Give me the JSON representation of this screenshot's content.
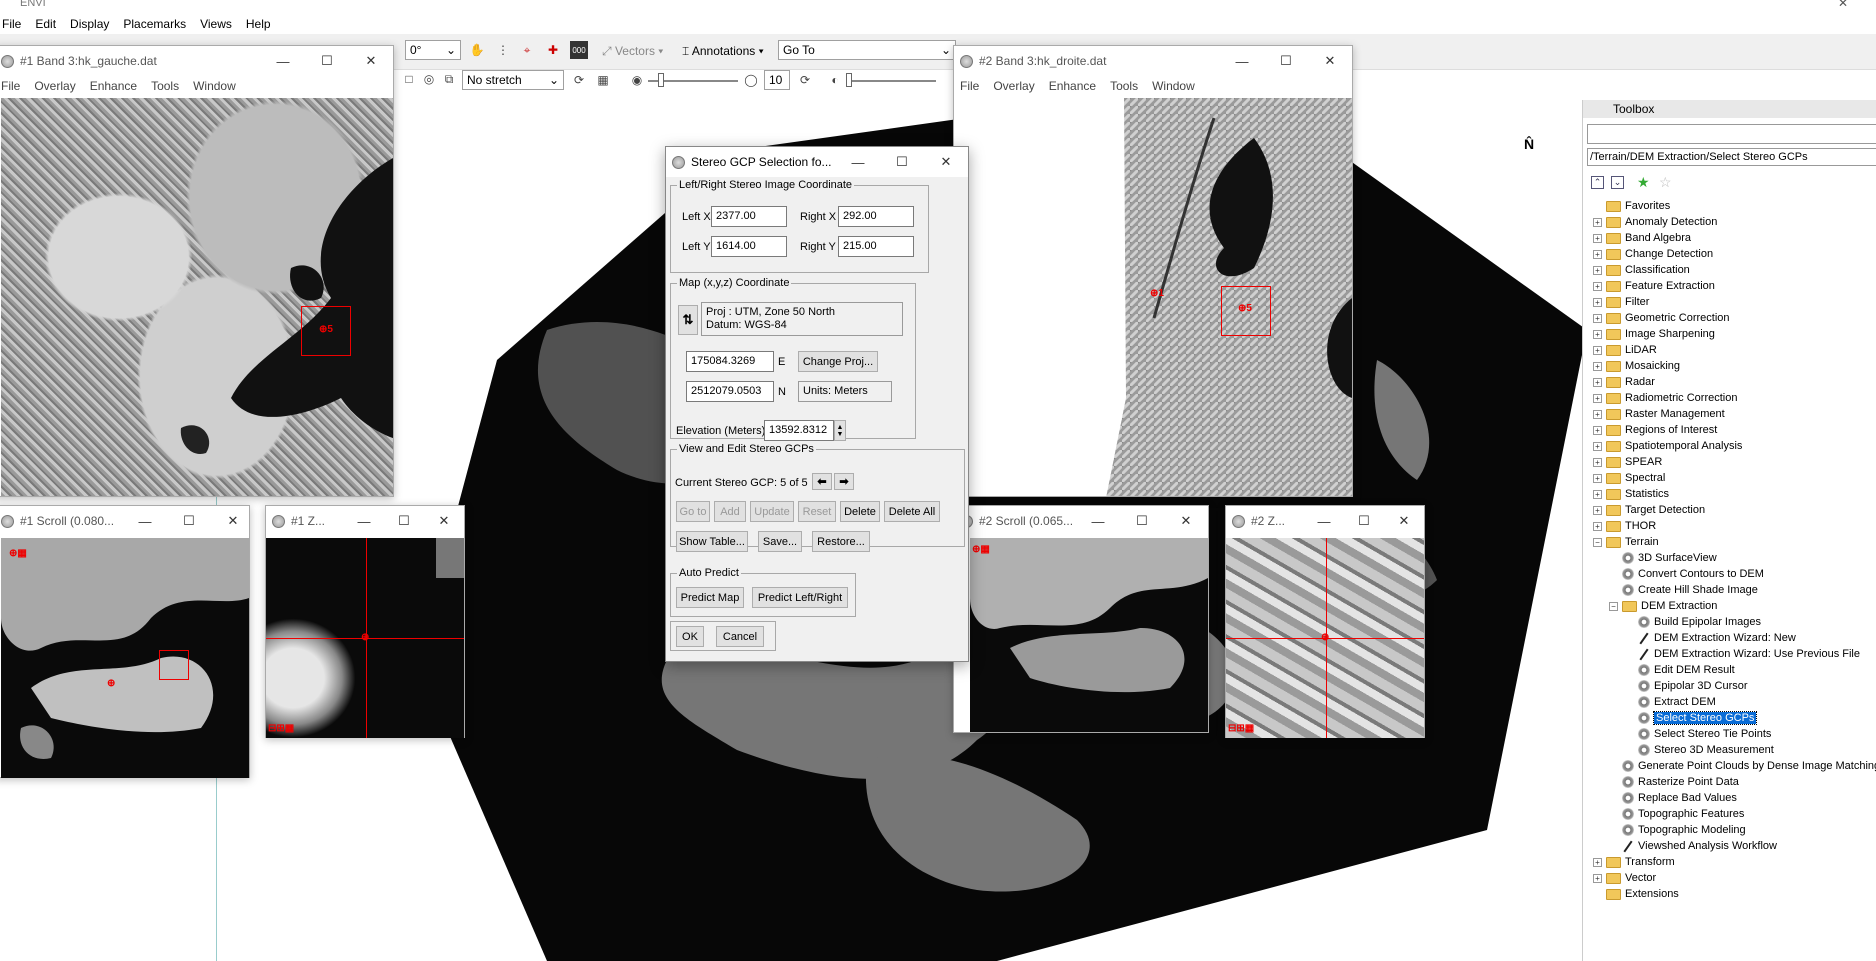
{
  "app": {
    "title": "ENVI"
  },
  "menubar": [
    "File",
    "Edit",
    "Display",
    "Placemarks",
    "Views",
    "Help"
  ],
  "toolbar": {
    "rotation": "0°",
    "vectors": "Vectors",
    "annotations": "Annotations",
    "goto": "Go To",
    "stretch": "No stretch",
    "sharpen_value": "10"
  },
  "win_left": {
    "title": "#1 Band 3:hk_gauche.dat",
    "menu": [
      "File",
      "Overlay",
      "Enhance",
      "Tools",
      "Window"
    ],
    "gcp": "5"
  },
  "win_right": {
    "title": "#2 Band 3:hk_droite.dat",
    "menu": [
      "File",
      "Overlay",
      "Enhance",
      "Tools",
      "Window"
    ],
    "gcp": "5",
    "gcp_other": "1"
  },
  "scroll_left": {
    "title": "#1 Scroll (0.080..."
  },
  "zoom_left": {
    "title": "#1 Z..."
  },
  "scroll_right": {
    "title": "#2 Scroll (0.065..."
  },
  "zoom_right": {
    "title": "#2 Z..."
  },
  "dialog": {
    "title": "Stereo GCP Selection fo...",
    "coord_group": "Left/Right Stereo Image Coordinate",
    "left_x_label": "Left X",
    "left_x": "2377.00",
    "right_x_label": "Right X",
    "right_x": "292.00",
    "left_y_label": "Left Y",
    "left_y": "1614.00",
    "right_y_label": "Right Y",
    "right_y": "215.00",
    "map_group": "Map (x,y,z) Coordinate",
    "proj": "Proj : UTM, Zone 50 North",
    "datum": "Datum: WGS-84",
    "easting": "175084.3269",
    "e_label": "E",
    "northing": "2512079.0503",
    "n_label": "N",
    "change_proj": "Change Proj...",
    "units": "Units: Meters",
    "elev_label": "Elevation (Meters)",
    "elev": "13592.8312",
    "view_group": "View and Edit Stereo GCPs",
    "current": "Current Stereo GCP: 5 of 5",
    "goto": "Go to",
    "add": "Add",
    "update": "Update",
    "reset": "Reset",
    "delete": "Delete",
    "delete_all": "Delete All",
    "show_table": "Show Table...",
    "save": "Save...",
    "restore": "Restore...",
    "auto_group": "Auto Predict",
    "predict_map": "Predict Map",
    "predict_lr": "Predict Left/Right",
    "ok": "OK",
    "cancel": "Cancel"
  },
  "toolbox": {
    "title": "Toolbox",
    "path": "/Terrain/DEM Extraction/Select Stereo GCPs",
    "items": [
      {
        "label": "Favorites",
        "kind": "folder",
        "level": 0,
        "exp": ""
      },
      {
        "label": "Anomaly Detection",
        "kind": "folder",
        "level": 0,
        "exp": "+"
      },
      {
        "label": "Band Algebra",
        "kind": "folder",
        "level": 0,
        "exp": "+"
      },
      {
        "label": "Change Detection",
        "kind": "folder",
        "level": 0,
        "exp": "+"
      },
      {
        "label": "Classification",
        "kind": "folder",
        "level": 0,
        "exp": "+"
      },
      {
        "label": "Feature Extraction",
        "kind": "folder",
        "level": 0,
        "exp": "+"
      },
      {
        "label": "Filter",
        "kind": "folder",
        "level": 0,
        "exp": "+"
      },
      {
        "label": "Geometric Correction",
        "kind": "folder",
        "level": 0,
        "exp": "+"
      },
      {
        "label": "Image Sharpening",
        "kind": "folder",
        "level": 0,
        "exp": "+"
      },
      {
        "label": "LiDAR",
        "kind": "folder",
        "level": 0,
        "exp": "+"
      },
      {
        "label": "Mosaicking",
        "kind": "folder",
        "level": 0,
        "exp": "+"
      },
      {
        "label": "Radar",
        "kind": "folder",
        "level": 0,
        "exp": "+"
      },
      {
        "label": "Radiometric Correction",
        "kind": "folder",
        "level": 0,
        "exp": "+"
      },
      {
        "label": "Raster Management",
        "kind": "folder",
        "level": 0,
        "exp": "+"
      },
      {
        "label": "Regions of Interest",
        "kind": "folder",
        "level": 0,
        "exp": "+"
      },
      {
        "label": "Spatiotemporal Analysis",
        "kind": "folder",
        "level": 0,
        "exp": "+"
      },
      {
        "label": "SPEAR",
        "kind": "folder",
        "level": 0,
        "exp": "+"
      },
      {
        "label": "Spectral",
        "kind": "folder",
        "level": 0,
        "exp": "+"
      },
      {
        "label": "Statistics",
        "kind": "folder",
        "level": 0,
        "exp": "+"
      },
      {
        "label": "Target Detection",
        "kind": "folder",
        "level": 0,
        "exp": "+"
      },
      {
        "label": "THOR",
        "kind": "folder",
        "level": 0,
        "exp": "+"
      },
      {
        "label": "Terrain",
        "kind": "folder",
        "level": 0,
        "exp": "−"
      },
      {
        "label": "3D SurfaceView",
        "kind": "gear",
        "level": 1,
        "exp": ""
      },
      {
        "label": "Convert Contours to DEM",
        "kind": "gear",
        "level": 1,
        "exp": ""
      },
      {
        "label": "Create Hill Shade Image",
        "kind": "gear",
        "level": 1,
        "exp": ""
      },
      {
        "label": "DEM Extraction",
        "kind": "folder",
        "level": 1,
        "exp": "−"
      },
      {
        "label": "Build Epipolar Images",
        "kind": "gear",
        "level": 2,
        "exp": ""
      },
      {
        "label": "DEM Extraction Wizard: New",
        "kind": "wand",
        "level": 2,
        "exp": ""
      },
      {
        "label": "DEM Extraction Wizard: Use Previous File",
        "kind": "wand",
        "level": 2,
        "exp": ""
      },
      {
        "label": "Edit DEM Result",
        "kind": "gear",
        "level": 2,
        "exp": ""
      },
      {
        "label": "Epipolar 3D Cursor",
        "kind": "gear",
        "level": 2,
        "exp": ""
      },
      {
        "label": "Extract DEM",
        "kind": "gear",
        "level": 2,
        "exp": ""
      },
      {
        "label": "Select Stereo GCPs",
        "kind": "gear",
        "level": 2,
        "exp": "",
        "selected": true
      },
      {
        "label": "Select Stereo Tie Points",
        "kind": "gear",
        "level": 2,
        "exp": ""
      },
      {
        "label": "Stereo 3D Measurement",
        "kind": "gear",
        "level": 2,
        "exp": ""
      },
      {
        "label": "Generate Point Clouds by Dense Image Matching",
        "kind": "gear",
        "level": 1,
        "exp": ""
      },
      {
        "label": "Rasterize Point Data",
        "kind": "gear",
        "level": 1,
        "exp": ""
      },
      {
        "label": "Replace Bad Values",
        "kind": "gear",
        "level": 1,
        "exp": ""
      },
      {
        "label": "Topographic Features",
        "kind": "gear",
        "level": 1,
        "exp": ""
      },
      {
        "label": "Topographic Modeling",
        "kind": "gear",
        "level": 1,
        "exp": ""
      },
      {
        "label": "Viewshed Analysis Workflow",
        "kind": "wand",
        "level": 1,
        "exp": ""
      },
      {
        "label": "Transform",
        "kind": "folder",
        "level": 0,
        "exp": "+"
      },
      {
        "label": "Vector",
        "kind": "folder",
        "level": 0,
        "exp": "+"
      },
      {
        "label": "Extensions",
        "kind": "folder",
        "level": 0,
        "exp": ""
      }
    ]
  }
}
